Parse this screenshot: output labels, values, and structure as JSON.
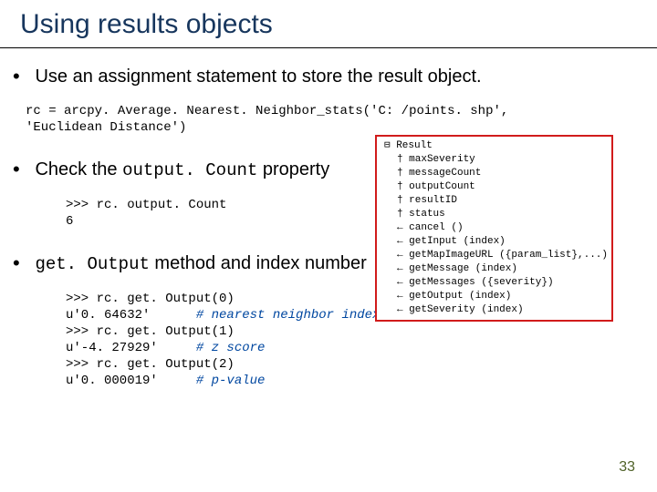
{
  "title": "Using results objects",
  "bullets": {
    "b0": "Use an assignment statement to store the result object.",
    "b1_pre": "Check the ",
    "b1_code": "output. Count",
    "b1_post": " property",
    "b2_code": "get. Output",
    "b2_post": " method and index number"
  },
  "code": {
    "assign_l1": "rc = arcpy. Average. Nearest. Neighbor_stats('C: /points. shp',",
    "assign_l2": "'Euclidean Distance')",
    "count_l1": ">>> rc. output. Count",
    "count_l2": "6",
    "out_l1_a": ">>> rc. get. Output(0)",
    "out_l2_a": "u'0. 64632'      ",
    "out_l2_c": "# nearest neighbor index",
    "out_l3_a": ">>> rc. get. Output(1)",
    "out_l4_a": "u'-4. 27929'     ",
    "out_l4_c": "# z score",
    "out_l5_a": ">>> rc. get. Output(2)",
    "out_l6_a": "u'0. 000019'     ",
    "out_l6_c": "# p-value"
  },
  "result_panel": {
    "head": "Result",
    "rows": {
      "r0": "maxSeverity",
      "r1": "messageCount",
      "r2": "outputCount",
      "r3": "resultID",
      "r4": "status",
      "r5": "cancel ()",
      "r6": "getInput (index)",
      "r7": "getMapImageURL ({param_list},...)",
      "r8": "getMessage (index)",
      "r9": "getMessages ({severity})",
      "r10": "getOutput (index)",
      "r11": "getSeverity (index)"
    }
  },
  "page_number": "33"
}
